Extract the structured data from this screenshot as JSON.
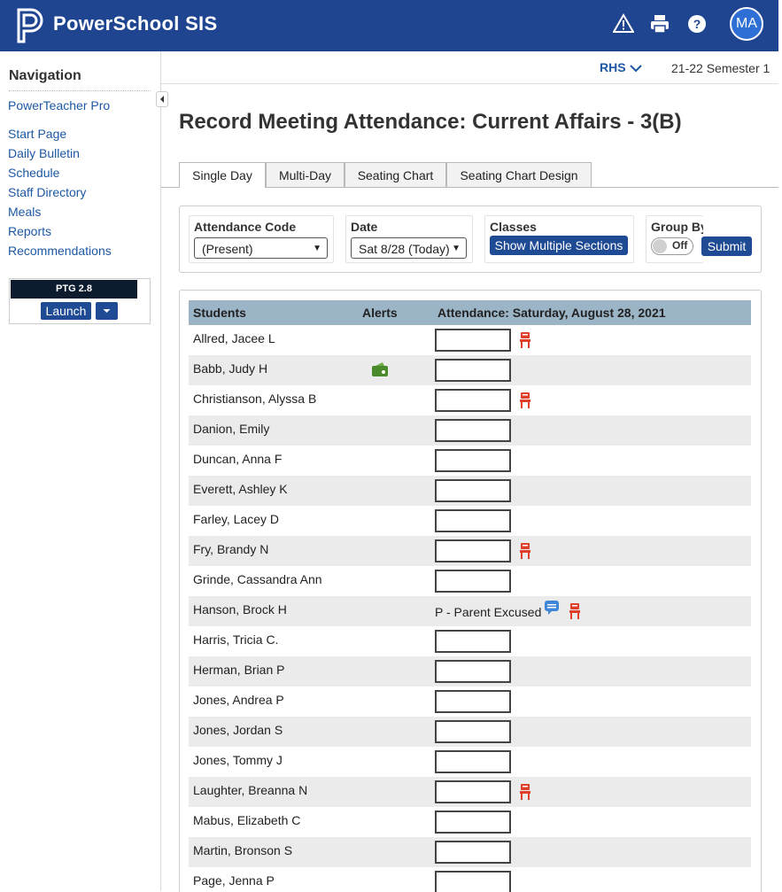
{
  "header": {
    "brand": "PowerSchool SIS",
    "user_initials": "MA",
    "brand_color": "#1f4590"
  },
  "sidebar": {
    "title": "Navigation",
    "links": [
      "PowerTeacher Pro",
      "Start Page",
      "Daily Bulletin",
      "Schedule",
      "Staff Directory",
      "Meals",
      "Reports",
      "Recommendations"
    ],
    "ptg_title": "PTG 2.8",
    "ptg_launch": "Launch"
  },
  "subheader": {
    "school": "RHS",
    "term": "21-22 Semester 1"
  },
  "page": {
    "title": "Record Meeting Attendance: Current Affairs - 3(B)"
  },
  "tabs": [
    "Single Day",
    "Multi-Day",
    "Seating Chart",
    "Seating Chart Design"
  ],
  "filters": {
    "attendance_code_label": "Attendance Code",
    "attendance_code_value": "(Present)",
    "date_label": "Date",
    "date_value": "Sat 8/28 (Today)",
    "classes_label": "Classes",
    "classes_button": "Show Multiple Sections",
    "group_by_label": "Group By",
    "toggle_label": "Off",
    "submit": "Submit"
  },
  "table": {
    "columns": [
      "Students",
      "Alerts",
      "Attendance: Saturday, August 28, 2021"
    ],
    "rows": [
      {
        "name": "Allred, Jacee L",
        "attendance": "",
        "seat_icon": true,
        "alert_icon": false,
        "comment_icon": false
      },
      {
        "name": "Babb, Judy H",
        "attendance": "",
        "seat_icon": false,
        "alert_icon": true,
        "comment_icon": false
      },
      {
        "name": "Christianson, Alyssa B",
        "attendance": "",
        "seat_icon": true,
        "alert_icon": false,
        "comment_icon": false
      },
      {
        "name": "Danion, Emily",
        "attendance": "",
        "seat_icon": false,
        "alert_icon": false,
        "comment_icon": false
      },
      {
        "name": "Duncan, Anna F",
        "attendance": "",
        "seat_icon": false,
        "alert_icon": false,
        "comment_icon": false
      },
      {
        "name": "Everett, Ashley K",
        "attendance": "",
        "seat_icon": false,
        "alert_icon": false,
        "comment_icon": false
      },
      {
        "name": "Farley, Lacey D",
        "attendance": "",
        "seat_icon": false,
        "alert_icon": false,
        "comment_icon": false
      },
      {
        "name": "Fry, Brandy N",
        "attendance": "",
        "seat_icon": true,
        "alert_icon": false,
        "comment_icon": false
      },
      {
        "name": "Grinde, Cassandra Ann",
        "attendance": "",
        "seat_icon": false,
        "alert_icon": false,
        "comment_icon": false
      },
      {
        "name": "Hanson, Brock H",
        "attendance": "P - Parent Excused",
        "seat_icon": true,
        "alert_icon": false,
        "comment_icon": true
      },
      {
        "name": "Harris, Tricia C.",
        "attendance": "",
        "seat_icon": false,
        "alert_icon": false,
        "comment_icon": false
      },
      {
        "name": "Herman, Brian P",
        "attendance": "",
        "seat_icon": false,
        "alert_icon": false,
        "comment_icon": false
      },
      {
        "name": "Jones, Andrea P",
        "attendance": "",
        "seat_icon": false,
        "alert_icon": false,
        "comment_icon": false
      },
      {
        "name": "Jones, Jordan S",
        "attendance": "",
        "seat_icon": false,
        "alert_icon": false,
        "comment_icon": false
      },
      {
        "name": "Jones, Tommy J",
        "attendance": "",
        "seat_icon": false,
        "alert_icon": false,
        "comment_icon": false
      },
      {
        "name": "Laughter, Breanna N",
        "attendance": "",
        "seat_icon": true,
        "alert_icon": false,
        "comment_icon": false
      },
      {
        "name": "Mabus, Elizabeth C",
        "attendance": "",
        "seat_icon": false,
        "alert_icon": false,
        "comment_icon": false
      },
      {
        "name": "Martin, Bronson S",
        "attendance": "",
        "seat_icon": false,
        "alert_icon": false,
        "comment_icon": false
      },
      {
        "name": "Page, Jenna P",
        "attendance": "",
        "seat_icon": false,
        "alert_icon": false,
        "comment_icon": false
      }
    ]
  },
  "colors": {
    "link": "#1d58a4",
    "button": "#1f4a94",
    "table_header": "#9bb4c6",
    "seat_icon": "#e0402a",
    "alert_icon": "#4a8a2a"
  }
}
